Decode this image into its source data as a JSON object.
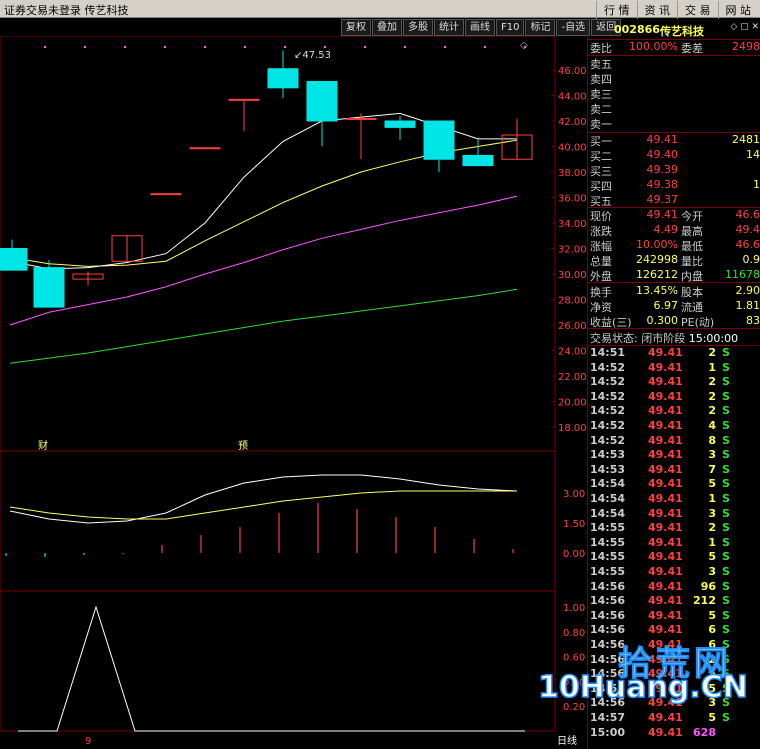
{
  "titlebar": {
    "title": "证券交易未登录  传艺科技",
    "menu": [
      "行 情",
      "资 讯",
      "交 易",
      "网 站"
    ]
  },
  "toolbar": [
    "复权",
    "叠加",
    "多股",
    "统计",
    "画线",
    "F10",
    "标记",
    "-自选",
    "返回"
  ],
  "colors": {
    "up": "#ff4040",
    "down": "#00e5e5",
    "ma5": "#ffffff",
    "ma10": "#ffff66",
    "ma20": "#ff55ff",
    "ma60": "#33dd33",
    "grid": "#7a0000"
  },
  "stock": {
    "code": "002866",
    "name": "传艺科技"
  },
  "orderbook": {
    "ratio_label": "委比",
    "ratio_value": "100.00%",
    "diff_label": "委差",
    "diff_value": "2498",
    "asks": [
      {
        "label": "卖五"
      },
      {
        "label": "卖四"
      },
      {
        "label": "卖三"
      },
      {
        "label": "卖二"
      },
      {
        "label": "卖一"
      }
    ],
    "bids": [
      {
        "label": "买一",
        "price": "49.41",
        "vol": "2481"
      },
      {
        "label": "买二",
        "price": "49.40",
        "vol": "14"
      },
      {
        "label": "买三",
        "price": "49.39",
        "vol": ""
      },
      {
        "label": "买四",
        "price": "49.38",
        "vol": "1"
      },
      {
        "label": "买五",
        "price": "49.37",
        "vol": ""
      }
    ]
  },
  "quote": [
    {
      "l1": "现价",
      "v1": "49.41",
      "l2": "今开",
      "v2": "46.6"
    },
    {
      "l1": "涨跌",
      "v1": "4.49",
      "l2": "最高",
      "v2": "49.4"
    },
    {
      "l1": "涨幅",
      "v1": "10.00%",
      "l2": "最低",
      "v2": "46.6"
    },
    {
      "l1": "总量",
      "v1": "242998",
      "l2": "量比",
      "v2": "0.9"
    },
    {
      "l1": "外盘",
      "v1": "126212",
      "l2": "内盘",
      "v2": "11678"
    }
  ],
  "fundamentals": [
    {
      "l1": "换手",
      "v1": "13.45%",
      "l2": "股本",
      "v2": "2.90"
    },
    {
      "l1": "净资",
      "v1": "6.97",
      "l2": "流通",
      "v2": "1.81"
    },
    {
      "l1": "收益(三)",
      "v1": "0.300",
      "l2": "PE(动)",
      "v2": "83"
    }
  ],
  "status": {
    "label": "交易状态:",
    "value": "闭市阶段",
    "time": "15:00:00"
  },
  "ticks": [
    {
      "t": "14:51",
      "p": "49.41",
      "q": "2",
      "s": "S"
    },
    {
      "t": "14:52",
      "p": "49.41",
      "q": "1",
      "s": "S"
    },
    {
      "t": "14:52",
      "p": "49.41",
      "q": "2",
      "s": "S"
    },
    {
      "t": "14:52",
      "p": "49.41",
      "q": "2",
      "s": "S"
    },
    {
      "t": "14:52",
      "p": "49.41",
      "q": "2",
      "s": "S"
    },
    {
      "t": "14:52",
      "p": "49.41",
      "q": "4",
      "s": "S"
    },
    {
      "t": "14:52",
      "p": "49.41",
      "q": "8",
      "s": "S"
    },
    {
      "t": "14:53",
      "p": "49.41",
      "q": "3",
      "s": "S"
    },
    {
      "t": "14:53",
      "p": "49.41",
      "q": "7",
      "s": "S"
    },
    {
      "t": "14:54",
      "p": "49.41",
      "q": "5",
      "s": "S"
    },
    {
      "t": "14:54",
      "p": "49.41",
      "q": "1",
      "s": "S"
    },
    {
      "t": "14:54",
      "p": "49.41",
      "q": "3",
      "s": "S"
    },
    {
      "t": "14:55",
      "p": "49.41",
      "q": "2",
      "s": "S"
    },
    {
      "t": "14:55",
      "p": "49.41",
      "q": "1",
      "s": "S"
    },
    {
      "t": "14:55",
      "p": "49.41",
      "q": "5",
      "s": "S"
    },
    {
      "t": "14:55",
      "p": "49.41",
      "q": "3",
      "s": "S"
    },
    {
      "t": "14:56",
      "p": "49.41",
      "q": "96",
      "s": "S"
    },
    {
      "t": "14:56",
      "p": "49.41",
      "q": "212",
      "s": "S"
    },
    {
      "t": "14:56",
      "p": "49.41",
      "q": "5",
      "s": "S"
    },
    {
      "t": "14:56",
      "p": "49.41",
      "q": "6",
      "s": "S"
    },
    {
      "t": "14:56",
      "p": "49.41",
      "q": "6",
      "s": "S"
    },
    {
      "t": "14:56",
      "p": "49.41",
      "q": "2",
      "s": "S"
    },
    {
      "t": "14:56",
      "p": "49.41",
      "q": "5",
      "s": "S"
    },
    {
      "t": "14:56",
      "p": "49.41",
      "q": "5",
      "s": "S"
    },
    {
      "t": "14:56",
      "p": "49.41",
      "q": "3",
      "s": "S"
    },
    {
      "t": "14:57",
      "p": "49.41",
      "q": "5",
      "s": "S"
    },
    {
      "t": "15:00",
      "p": "49.41",
      "q": "628",
      "s": ""
    }
  ],
  "chart": {
    "price_axis": [
      "46.00",
      "44.00",
      "42.00",
      "40.00",
      "38.00",
      "36.00",
      "34.00",
      "32.00",
      "30.00",
      "28.00",
      "26.00",
      "24.00",
      "22.00",
      "20.00",
      "18.00"
    ],
    "macd_axis": [
      "3.00",
      "1.50",
      "0.00"
    ],
    "kdj_axis": [
      "1.00",
      "0.80",
      "0.60",
      "0.40",
      "0.20"
    ],
    "high_label": "47.53",
    "markers": [
      "财",
      "预"
    ],
    "bottom_label": "9",
    "bottom_tab": "日线",
    "candles": [
      {
        "o": 32.0,
        "c": 30.3,
        "h": 32.7,
        "l": 30.3
      },
      {
        "o": 30.5,
        "c": 27.4,
        "h": 31.1,
        "l": 27.4
      },
      {
        "o": 29.6,
        "c": 30.0,
        "h": 30.2,
        "l": 29.1
      },
      {
        "o": 31.0,
        "c": 33.0,
        "h": 33.0,
        "l": 31.0
      },
      {
        "o": 36.3,
        "c": 36.3,
        "h": 36.3,
        "l": 36.3
      },
      {
        "o": 39.9,
        "c": 39.9,
        "h": 39.9,
        "l": 39.9
      },
      {
        "o": 43.7,
        "c": 43.7,
        "h": 43.7,
        "l": 41.2
      },
      {
        "o": 46.1,
        "c": 44.6,
        "h": 47.53,
        "l": 43.8
      },
      {
        "o": 45.1,
        "c": 42.0,
        "h": 45.1,
        "l": 40.0
      },
      {
        "o": 42.2,
        "c": 42.2,
        "h": 42.6,
        "l": 39.0
      },
      {
        "o": 42.0,
        "c": 41.5,
        "h": 42.4,
        "l": 40.5
      },
      {
        "o": 42.0,
        "c": 39.0,
        "h": 42.0,
        "l": 38.0
      },
      {
        "o": 39.3,
        "c": 38.5,
        "h": 40.7,
        "l": 38.5
      },
      {
        "o": 39.0,
        "c": 40.9,
        "h": 42.2,
        "l": 39.0
      }
    ],
    "ma5": [
      31.0,
      30.4,
      30.5,
      30.9,
      31.6,
      34.0,
      37.6,
      40.4,
      42.0,
      42.3,
      42.6,
      41.6,
      40.6,
      40.6
    ],
    "ma10": [
      31.3,
      30.8,
      30.6,
      30.7,
      31.0,
      32.6,
      34.1,
      35.6,
      36.9,
      38.0,
      38.8,
      39.5,
      40.0,
      40.5
    ],
    "ma20": [
      26.0,
      27.0,
      27.6,
      28.2,
      29.0,
      30.0,
      30.9,
      31.9,
      32.8,
      33.5,
      34.2,
      34.8,
      35.4,
      36.1
    ],
    "ma60": [
      23.0,
      23.4,
      23.8,
      24.3,
      24.8,
      25.3,
      25.8,
      26.3,
      26.7,
      27.1,
      27.5,
      27.9,
      28.3,
      28.8
    ],
    "macd_bars": [
      -0.15,
      -0.2,
      -0.1,
      -0.05,
      0.4,
      0.9,
      1.3,
      2.0,
      2.5,
      2.2,
      1.8,
      1.3,
      0.7,
      0.2
    ],
    "dif": [
      2.1,
      1.7,
      1.5,
      1.6,
      2.0,
      2.9,
      3.5,
      3.8,
      3.9,
      3.9,
      3.7,
      3.4,
      3.2,
      3.1
    ],
    "dea": [
      2.3,
      2.0,
      1.8,
      1.7,
      1.7,
      2.0,
      2.3,
      2.6,
      2.8,
      3.0,
      3.1,
      3.1,
      3.1,
      3.1
    ],
    "kdj": [
      0.0,
      0.0,
      1.0,
      0.0,
      0.0,
      0.0,
      0.0,
      0.0,
      0.0,
      0.0,
      0.0,
      0.0,
      0.0,
      0.0
    ]
  },
  "watermark": {
    "cn": "拾荒网",
    "en": "10Huang.CN"
  }
}
